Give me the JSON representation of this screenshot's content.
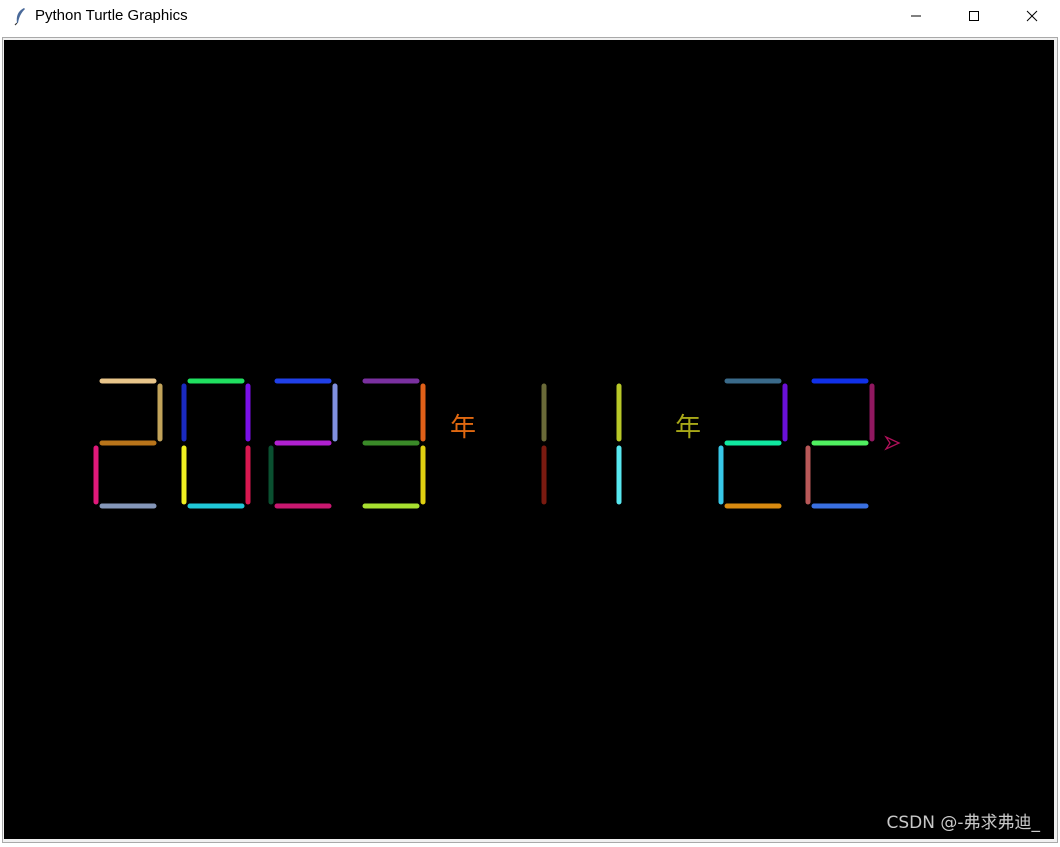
{
  "window": {
    "title": "Python Turtle Graphics",
    "icon": "feather-icon",
    "controls": [
      "minimize-icon",
      "maximize-icon",
      "close-icon"
    ]
  },
  "canvas": {
    "background": "#000000",
    "date_text": "2023 年 11 年 22",
    "digits": [
      {
        "char": "2",
        "colors": {
          "a": "#e8c58a",
          "b": "#c2a35a",
          "g": "#b8741a",
          "e": "#e0197a",
          "d": "#8496b8"
        }
      },
      {
        "char": "0",
        "colors": {
          "a": "#20e060",
          "b": "#7a10e8",
          "c": "#d81850",
          "d": "#20c8d8",
          "e": "#f0f020",
          "f": "#1a2ac0"
        }
      },
      {
        "char": "2",
        "colors": {
          "a": "#2040e8",
          "b": "#8090e0",
          "g": "#b020d0",
          "e": "#0a5030",
          "d": "#c81870"
        }
      },
      {
        "char": "3",
        "colors": {
          "a": "#7a30a0",
          "b": "#e06018",
          "g": "#3a8a28",
          "c": "#e0d010",
          "d": "#a8e030"
        }
      },
      {
        "char": "1",
        "colors": {
          "b": "#6a6a38",
          "c": "#7a1a10"
        }
      },
      {
        "char": "1",
        "colors": {
          "b": "#b8c828",
          "c": "#58e8f0"
        }
      },
      {
        "char": "2",
        "colors": {
          "a": "#3a6a8a",
          "b": "#6a10d8",
          "g": "#10e8a0",
          "e": "#38c8e8",
          "d": "#d88a10"
        }
      },
      {
        "char": "2",
        "colors": {
          "a": "#1030e8",
          "b": "#901860",
          "g": "#50f060",
          "e": "#b85858",
          "d": "#3a70e0"
        }
      }
    ],
    "separators": [
      {
        "text": "年",
        "color": "#e06810"
      },
      {
        "text": "年",
        "color": "#a8a818"
      }
    ],
    "turtle_color": "#b0105a"
  },
  "watermark": "CSDN @-弗求弗迪_"
}
